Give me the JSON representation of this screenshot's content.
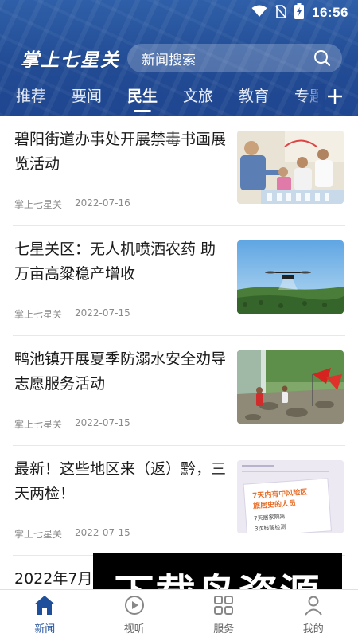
{
  "statusbar": {
    "time": "16:56",
    "icons": [
      "wifi-icon",
      "no-sim-icon",
      "battery-charging-icon"
    ]
  },
  "header": {
    "logo_text": "掌上七星关",
    "search_placeholder": "新闻搜索",
    "search_icon": "search-icon",
    "add_tab_icon": "plus-icon"
  },
  "tabs": [
    {
      "label": "推荐",
      "active": false
    },
    {
      "label": "要闻",
      "active": false
    },
    {
      "label": "民生",
      "active": true
    },
    {
      "label": "文旅",
      "active": false
    },
    {
      "label": "教育",
      "active": false
    },
    {
      "label": "专题",
      "active": false
    }
  ],
  "articles": [
    {
      "title": "碧阳街道办事处开展禁毒书画展览活动",
      "source": "掌上七星关",
      "date": "2022-07-16"
    },
    {
      "title": "七星关区：无人机喷洒农药 助万亩高粱稳产增收",
      "source": "掌上七星关",
      "date": "2022-07-15"
    },
    {
      "title": "鸭池镇开展夏季防溺水安全劝导志愿服务活动",
      "source": "掌上七星关",
      "date": "2022-07-15"
    },
    {
      "title": "最新！这些地区来（返）黔，三天两检！",
      "source": "掌上七星关",
      "date": "2022-07-15",
      "thumb_text": {
        "line1": "7天内有中风险区",
        "line2": "旅居史的人员",
        "item1": "7天居家隔离",
        "item2": "3次核酸检测"
      }
    },
    {
      "title": "2022年7月"
    }
  ],
  "watermark": {
    "text": "下载鸟资源"
  },
  "bottom_nav": [
    {
      "label": "新闻",
      "icon": "home-icon",
      "active": true
    },
    {
      "label": "视听",
      "icon": "play-icon",
      "active": false
    },
    {
      "label": "服务",
      "icon": "grid-icon",
      "active": false
    },
    {
      "label": "我的",
      "icon": "user-icon",
      "active": false
    }
  ],
  "colors": {
    "brand_blue": "#1f4f9a",
    "header_blue": "#224c95",
    "text": "#1b1b1b",
    "meta": "#8a8a8a"
  }
}
